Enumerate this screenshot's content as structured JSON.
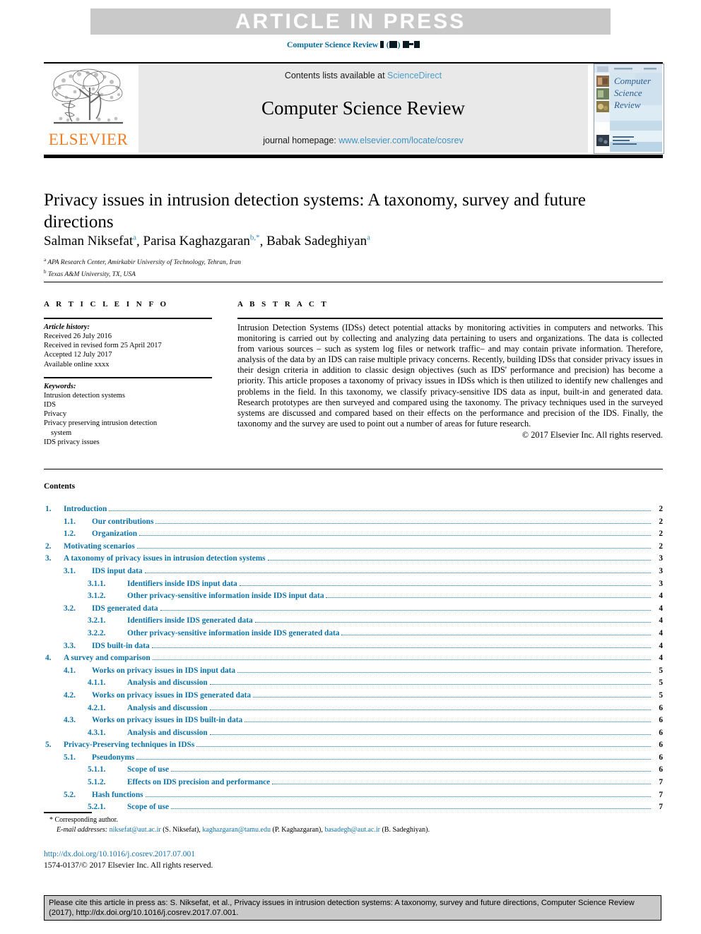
{
  "banner": {
    "text": "ARTICLE IN PRESS"
  },
  "journal_line": {
    "name": "Computer Science Review",
    "volume_placeholder": "( ) –"
  },
  "masthead": {
    "contents_prefix": "Contents lists available at",
    "sciencedirect": "ScienceDirect",
    "journal_title": "Computer Science Review",
    "homepage_prefix": "journal homepage:",
    "homepage_url": "www.elsevier.com/locate/cosrev",
    "publisher": "ELSEVIER",
    "cover_lines": [
      "Computer",
      "Science",
      "Review"
    ]
  },
  "article": {
    "title": "Privacy issues in intrusion detection systems: A taxonomy, survey and future directions",
    "authors": [
      {
        "name": "Salman Niksefat",
        "marks": "a"
      },
      {
        "name": "Parisa Kaghazgaran",
        "marks": "b,*"
      },
      {
        "name": "Babak Sadeghiyan",
        "marks": "a"
      }
    ],
    "affiliations": [
      {
        "mark": "a",
        "text": "APA Research Center, Amirkabir University of Technology, Tehran, Iran"
      },
      {
        "mark": "b",
        "text": "Texas A&M University, TX, USA"
      }
    ]
  },
  "info": {
    "heading": "A R T I C L E   I N F O",
    "history_label": "Article history:",
    "history": [
      "Received 26 July 2016",
      "Received in revised form 25 April 2017",
      "Accepted 12 July 2017",
      "Available online xxxx"
    ],
    "keywords_label": "Keywords:",
    "keywords": [
      "Intrusion detection systems",
      "IDS",
      "Privacy",
      "Privacy preserving intrusion detection",
      "system",
      "IDS privacy issues"
    ]
  },
  "abstract": {
    "heading": "A B S T R A C T",
    "text": "Intrusion Detection Systems (IDSs) detect potential attacks by monitoring activities in computers and networks. This monitoring is carried out by collecting and analyzing data pertaining to users and organizations. The data is collected from various sources – such as system log files or network traffic– and may contain private information. Therefore, analysis of the data by an IDS can raise multiple privacy concerns. Recently, building IDSs that consider privacy issues in their design criteria in addition to classic design objectives (such as IDS' performance and precision) has become a priority. This article proposes a taxonomy of privacy issues in IDSs which is then utilized to identify new challenges and problems in the field. In this taxonomy, we classify privacy-sensitive IDS data as input, built-in and generated data. Research prototypes are then surveyed and compared using the taxonomy. The privacy techniques used in the surveyed systems are discussed and compared based on their effects on the performance and precision of the IDS. Finally, the taxonomy and the survey are used to point out a number of areas for future research.",
    "copyright": "© 2017 Elsevier Inc. All rights reserved."
  },
  "contents": {
    "heading": "Contents",
    "entries": [
      {
        "level": 1,
        "num": "1.",
        "label": "Introduction",
        "page": "2"
      },
      {
        "level": 2,
        "num": "1.1.",
        "label": "Our contributions",
        "page": "2"
      },
      {
        "level": 2,
        "num": "1.2.",
        "label": "Organization",
        "page": "2"
      },
      {
        "level": 1,
        "num": "2.",
        "label": "Motivating scenarios",
        "page": "2"
      },
      {
        "level": 1,
        "num": "3.",
        "label": "A taxonomy of privacy issues in intrusion detection systems",
        "page": "3"
      },
      {
        "level": 2,
        "num": "3.1.",
        "label": "IDS input data",
        "page": "3"
      },
      {
        "level": 3,
        "num": "3.1.1.",
        "label": "Identifiers inside IDS input data",
        "page": "3"
      },
      {
        "level": 3,
        "num": "3.1.2.",
        "label": "Other privacy-sensitive information inside IDS input data",
        "page": "4"
      },
      {
        "level": 2,
        "num": "3.2.",
        "label": "IDS generated data",
        "page": "4"
      },
      {
        "level": 3,
        "num": "3.2.1.",
        "label": "Identifiers inside IDS generated data",
        "page": "4"
      },
      {
        "level": 3,
        "num": "3.2.2.",
        "label": "Other privacy-sensitive information inside IDS generated data",
        "page": "4"
      },
      {
        "level": 2,
        "num": "3.3.",
        "label": "IDS built-in data",
        "page": "4"
      },
      {
        "level": 1,
        "num": "4.",
        "label": "A survey and comparison",
        "page": "4"
      },
      {
        "level": 2,
        "num": "4.1.",
        "label": "Works on privacy issues in IDS input data",
        "page": "5"
      },
      {
        "level": 3,
        "num": "4.1.1.",
        "label": "Analysis and discussion",
        "page": "5"
      },
      {
        "level": 2,
        "num": "4.2.",
        "label": "Works on privacy issues in IDS generated data",
        "page": "5"
      },
      {
        "level": 3,
        "num": "4.2.1.",
        "label": "Analysis and discussion",
        "page": "6"
      },
      {
        "level": 2,
        "num": "4.3.",
        "label": "Works on privacy issues in IDS built-in data",
        "page": "6"
      },
      {
        "level": 3,
        "num": "4.3.1.",
        "label": "Analysis and discussion",
        "page": "6"
      },
      {
        "level": 1,
        "num": "5.",
        "label": "Privacy-Preserving techniques in IDSs",
        "page": "6"
      },
      {
        "level": 2,
        "num": "5.1.",
        "label": "Pseudonyms",
        "page": "6"
      },
      {
        "level": 3,
        "num": "5.1.1.",
        "label": "Scope of use",
        "page": "6"
      },
      {
        "level": 3,
        "num": "5.1.2.",
        "label": "Effects on IDS precision and performance",
        "page": "7"
      },
      {
        "level": 2,
        "num": "5.2.",
        "label": "Hash functions",
        "page": "7"
      },
      {
        "level": 3,
        "num": "5.2.1.",
        "label": "Scope of use",
        "page": "7"
      }
    ]
  },
  "footnotes": {
    "corresponding": "* Corresponding author.",
    "email_label": "E-mail addresses:",
    "emails": [
      {
        "address": "niksefat@aut.ac.ir",
        "owner": "(S. Niksefat),"
      },
      {
        "address": "kaghazgaran@tamu.edu",
        "owner": "(P. Kaghazgaran),"
      },
      {
        "address": "basadegh@aut.ac.ir",
        "owner": "(B. Sadeghiyan)."
      }
    ],
    "doi": "http://dx.doi.org/10.1016/j.cosrev.2017.07.001",
    "issn": "1574-0137/© 2017 Elsevier Inc. All rights reserved."
  },
  "cite_box": {
    "text": "Please cite this article in press as: S. Niksefat, et al., Privacy issues in intrusion detection systems: A taxonomy, survey and future directions, Computer Science Review (2017), http://dx.doi.org/10.1016/j.cosrev.2017.07.001."
  },
  "colors": {
    "link_blue": "#1572a8",
    "toc_blue": "#0b72a8",
    "journal_blue": "#0a6d9c",
    "sciencedirect_blue": "#4e9ec9",
    "elsevier_orange": "#ef7d23",
    "banner_grey": "#c9c9c9"
  }
}
